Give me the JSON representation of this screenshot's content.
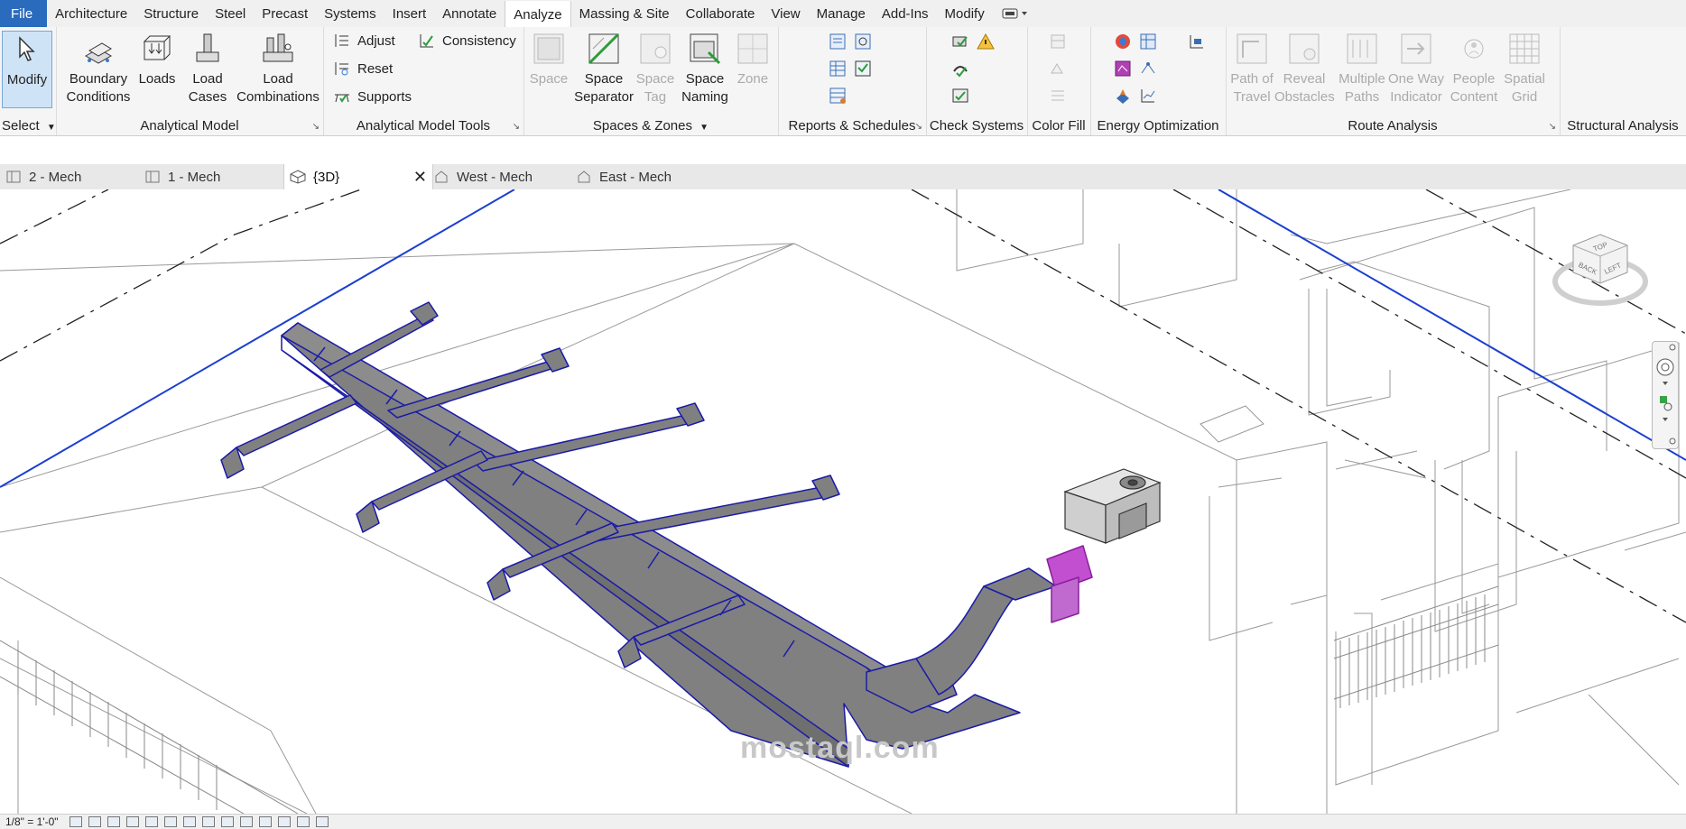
{
  "menu": {
    "file": "File",
    "tabs": [
      "Architecture",
      "Structure",
      "Steel",
      "Precast",
      "Systems",
      "Insert",
      "Annotate",
      "Analyze",
      "Massing & Site",
      "Collaborate",
      "View",
      "Manage",
      "Add-Ins",
      "Modify"
    ],
    "active": "Analyze"
  },
  "ribbon": {
    "select": {
      "title": "Select",
      "modify": "Modify"
    },
    "analytical_model": {
      "title": "Analytical Model",
      "boundary": "Boundary Conditions",
      "loads": "Loads",
      "load_cases": "Load Cases",
      "load_combinations": "Load Combinations"
    },
    "analytical_model_tools": {
      "title": "Analytical Model Tools",
      "adjust": "Adjust",
      "consistency": "Consistency",
      "reset": "Reset",
      "supports": "Supports"
    },
    "spaces_zones": {
      "title": "Spaces & Zones",
      "space": "Space",
      "space_separator": "Space Separator",
      "space_tag": "Space Tag",
      "space_naming": "Space Naming",
      "zone": "Zone"
    },
    "reports": {
      "title": "Reports & Schedules"
    },
    "check_systems": {
      "title": "Check Systems"
    },
    "color_fill": {
      "title": "Color Fill"
    },
    "energy": {
      "title": "Energy Optimization"
    },
    "route_analysis": {
      "title": "Route Analysis",
      "path_of_travel": "Path of Travel",
      "reveal_obstacles": "Reveal Obstacles",
      "multiple_paths": "Multiple Paths",
      "one_way_indicator": "One Way Indicator",
      "people_content": "People Content",
      "spatial_grid": "Spatial Grid"
    },
    "structural_analysis": {
      "title": "Structural Analysis"
    }
  },
  "views": {
    "tabs": [
      {
        "label": "2 - Mech"
      },
      {
        "label": "1 - Mech"
      },
      {
        "label": "{3D}"
      },
      {
        "label": "West - Mech"
      },
      {
        "label": "East - Mech"
      }
    ],
    "active": "{3D}"
  },
  "viewcube": {
    "top": "TOP",
    "back": "BACK",
    "left": "LEFT"
  },
  "watermark": "mostaql.com",
  "status": {
    "scale": "1/8\" = 1'-0\""
  },
  "colors": {
    "duct_fill": "#808080",
    "duct_edge": "#1a1aa8",
    "equipment_highlight": "#b048c8",
    "file_tab": "#2a6bbd"
  }
}
